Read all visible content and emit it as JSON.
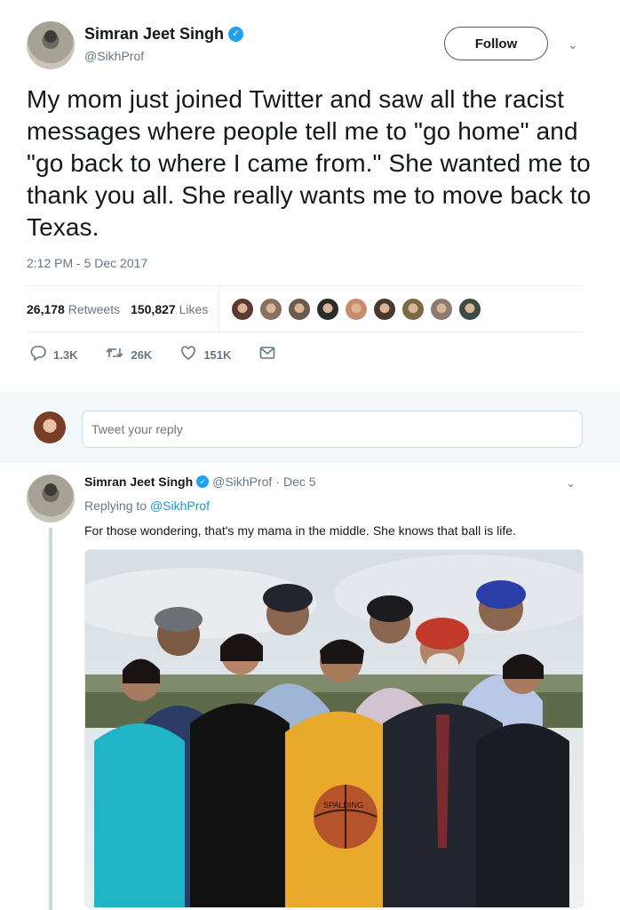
{
  "tweet": {
    "author": {
      "name": "Simran Jeet Singh",
      "handle": "@SikhProf"
    },
    "follow_label": "Follow",
    "text": "My mom just joined Twitter and saw all the racist messages where people tell me to \"go home\" and \"go back to where I came from.\" She wanted me to thank you all. She really wants me to move back to Texas.",
    "timestamp": "2:12 PM - 5 Dec 2017",
    "stats": {
      "retweets_count": "26,178",
      "retweets_label": "Retweets",
      "likes_count": "150,827",
      "likes_label": "Likes"
    },
    "actions": {
      "replies": "1.3K",
      "retweets": "26K",
      "likes": "151K"
    },
    "liker_colors": [
      "#5a3a2c",
      "#8a6f5e",
      "#6b5a4e",
      "#2d2a2a",
      "#c98b6b",
      "#4a3a2e",
      "#7a6a42",
      "#8e7a6e",
      "#3d4b45"
    ]
  },
  "reply_box": {
    "placeholder": "Tweet your reply"
  },
  "reply": {
    "author": {
      "name": "Simran Jeet Singh",
      "handle": "@SikhProf"
    },
    "date": "Dec 5",
    "replying_prefix": "Replying to",
    "replying_to": "@SikhProf",
    "text": "For those wondering, that's my mama in the middle. She knows that ball is life.",
    "photo_ball_text": "SPALDING"
  },
  "colors": {
    "accent": "#1da1f2",
    "link": "#1b95e0",
    "muted": "#657786"
  }
}
